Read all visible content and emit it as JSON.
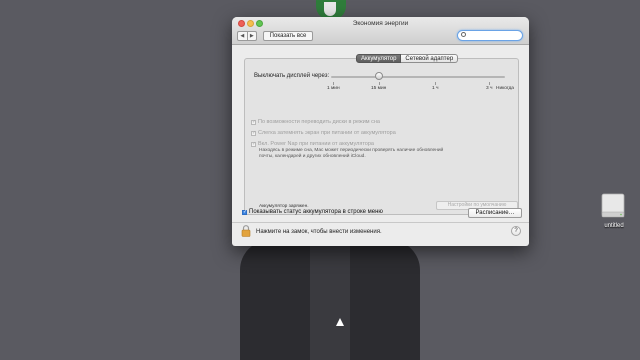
{
  "window": {
    "title": "Экономия энергии",
    "show_all_label": "Показать все",
    "search_placeholder": "",
    "back_arrow": "◀",
    "forward_arrow": "▶"
  },
  "tabs": [
    {
      "label": "Аккумулятор",
      "active": true
    },
    {
      "label": "Сетевой адаптер",
      "active": false
    }
  ],
  "display_sleep": {
    "label": "Выключать дисплей через:",
    "ticks": [
      "1 мин",
      "15 мин",
      "1 ч",
      "3 ч",
      "Никогда"
    ],
    "selected": "15 мин"
  },
  "options": [
    {
      "label": "По возможности переводить диски в режим сна",
      "checked": true
    },
    {
      "label": "Слегка затемнять экран при питании от аккумулятора",
      "checked": true
    },
    {
      "label": "Вкл. Power Nap при питании от аккумулятора",
      "checked": true
    }
  ],
  "powernap_description": "Находясь в режиме сна, Mac может периодически проверять наличие обновлений почты, календарей и других обновлений iCloud.",
  "battery_status": "Аккумулятор заряжен.",
  "defaults_button": "Настройки по умолчанию",
  "show_status": {
    "label": "Показывать статус аккумулятора в строке меню",
    "checked": true
  },
  "schedule_button": "Расписание…",
  "lock_text": "Нажмите на замок, чтобы внести изменения.",
  "help_label": "?",
  "desktop": {
    "drive_label": "untitled"
  },
  "colors": {
    "accent": "#3b83e0",
    "desktop": "#5a5a61"
  }
}
